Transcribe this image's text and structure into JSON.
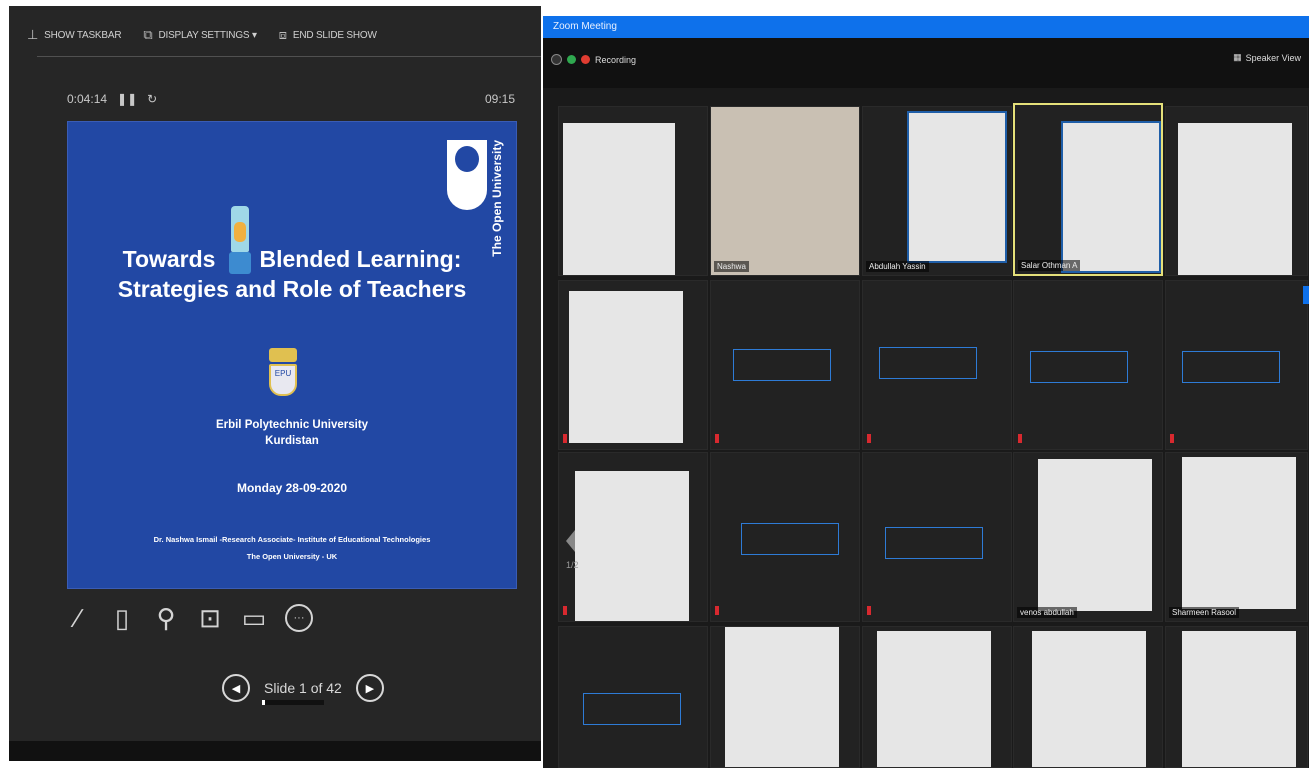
{
  "presenter": {
    "toolbar": {
      "show_taskbar": "SHOW TASKBAR",
      "display_settings": "DISPLAY SETTINGS ▾",
      "end_slide_show": "END SLIDE SHOW"
    },
    "elapsed": "0:04:14",
    "clock": "09:15",
    "slide": {
      "brand": "The Open University",
      "title_line1_left": "Towards",
      "title_line1_right": "Blended Learning:",
      "title_line2": "Strategies and Role of Teachers",
      "crest_label": "EPU",
      "university": "Erbil Polytechnic University",
      "region": "Kurdistan",
      "date": "Monday 28-09-2020",
      "credit_line1": "Dr. Nashwa Ismail -Research Associate- Institute of Educational Technologies",
      "credit_line2": "The Open University - UK"
    },
    "slide_counter": "Slide 1 of 42",
    "slide_progress": 0.024
  },
  "zoom": {
    "title": "Zoom Meeting",
    "recording": "Recording",
    "speaker_view": "Speaker View",
    "page_indicator": "1/2",
    "colors": {
      "titlebar": "#0e71eb",
      "active_speaker": "#e5e07a",
      "recording": "#e03c31"
    },
    "participants": {
      "nashwa": "Nashwa",
      "abdullah": "Abdullah Yassin",
      "salar": "Salar Othman A",
      "venos": "venos abdullah",
      "sharmeen": "Sharmeen Rasool"
    }
  }
}
